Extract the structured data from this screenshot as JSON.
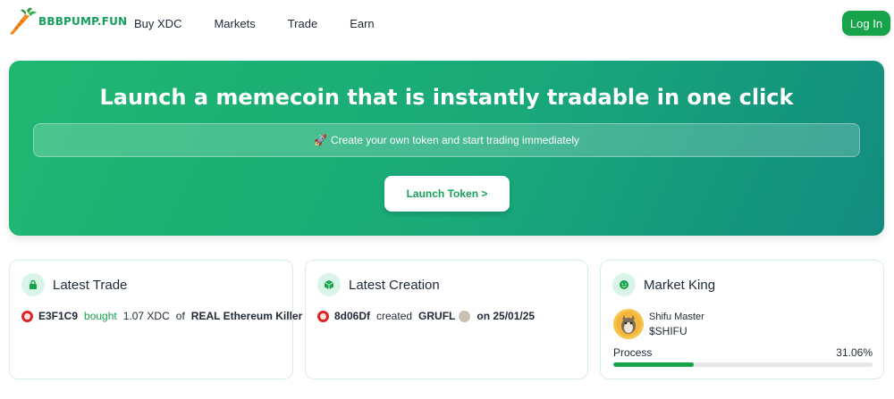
{
  "header": {
    "logo_text": "BBBPUMP.FUN",
    "nav": [
      "Buy XDC",
      "Markets",
      "Trade",
      "Earn"
    ],
    "login_label": "Log In"
  },
  "hero": {
    "title": "Launch a memecoin that is instantly tradable in one click",
    "subtitle": "Create your own token and start trading immediately",
    "subtitle_icon": "rocket-icon",
    "button_label": "Launch Token >"
  },
  "latest_trade": {
    "title": "Latest Trade",
    "icon": "lock-icon",
    "address": "E3F1C9",
    "action": "bought",
    "amount": "1.07 XDC",
    "preposition": "of",
    "token": "REAL Ethereum Killer"
  },
  "latest_creation": {
    "title": "Latest Creation",
    "icon": "cube-icon",
    "address": "8d06Df",
    "action": "created",
    "token": "GRUFL",
    "date_text": "on 25/01/25"
  },
  "market_king": {
    "title": "Market King",
    "icon": "smile-icon",
    "name": "Shifu Master",
    "ticker": "$SHIFU",
    "process_label": "Process",
    "process_value": "31.06%",
    "process_fraction": 0.3106
  },
  "colors": {
    "brand_green": "#16a34a",
    "hero_start": "#1fb870",
    "hero_end": "#128c7f"
  }
}
